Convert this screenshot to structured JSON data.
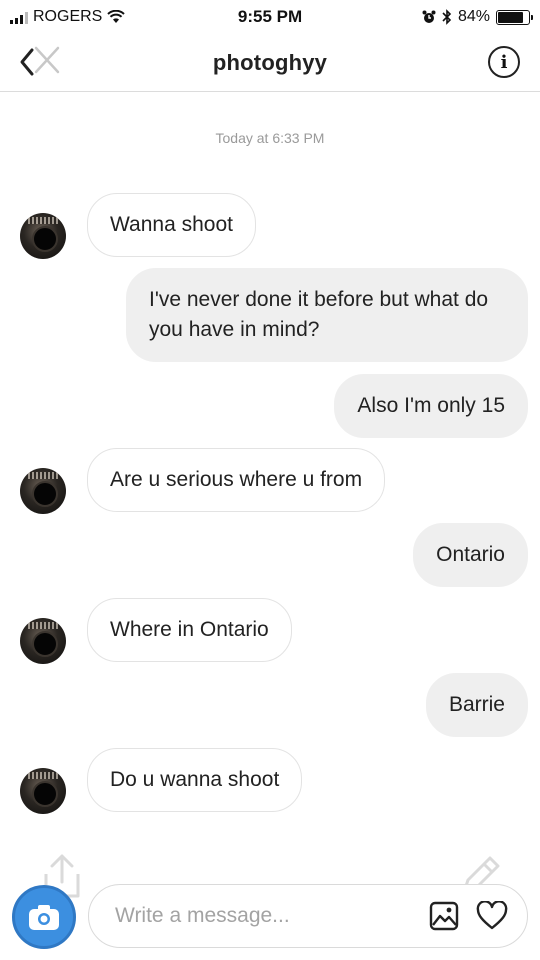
{
  "status_bar": {
    "carrier": "ROGERS",
    "time": "9:55 PM",
    "battery_text": "84%",
    "battery_level": 0.84
  },
  "header": {
    "title": "photoghyy"
  },
  "conversation": {
    "timestamp": "Today at 6:33 PM",
    "messages": [
      {
        "direction": "in",
        "text": "Wanna shoot"
      },
      {
        "direction": "out",
        "text": "I've never done it before but what do you have in mind?"
      },
      {
        "direction": "out",
        "text": "Also I'm only 15"
      },
      {
        "direction": "in",
        "text": "Are u serious where u from"
      },
      {
        "direction": "out",
        "text": "Ontario"
      },
      {
        "direction": "in",
        "text": "Where in Ontario"
      },
      {
        "direction": "out",
        "text": "Barrie"
      },
      {
        "direction": "in",
        "text": "Do u wanna shoot"
      }
    ]
  },
  "composer": {
    "placeholder": "Write a message...",
    "value": ""
  },
  "icons": {
    "back": "chevron-left-icon",
    "info": "info-icon",
    "camera": "camera-icon",
    "gallery": "image-icon",
    "like": "heart-icon"
  },
  "colors": {
    "incoming_bubble_border": "#e3e3e3",
    "outgoing_bubble": "#efefef",
    "camera_button": "#3c8fe0",
    "timestamp_text": "#9a9a9a"
  }
}
